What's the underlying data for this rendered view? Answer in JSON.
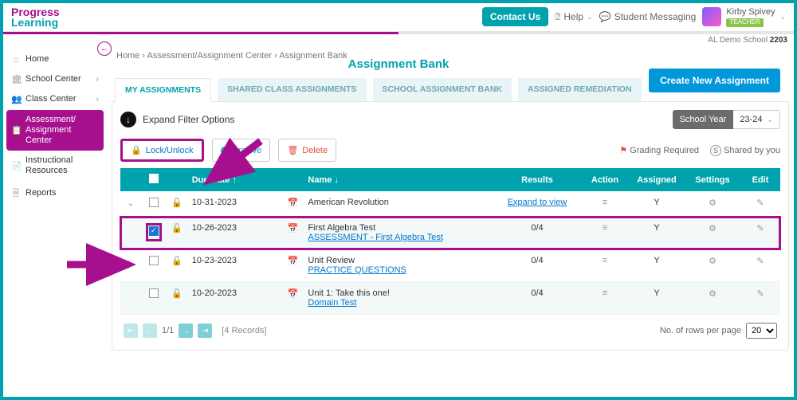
{
  "header": {
    "brand_p1": "Progress",
    "brand_p2": "Learning",
    "contact_label": "Contact Us",
    "help_label": "Help",
    "messaging_label": "Student Messaging",
    "user_name": "Kirby Spivey",
    "user_role": "TEACHER",
    "school_line_prefix": "AL Demo School ",
    "school_line_bold": "2203"
  },
  "sidebar": {
    "items": [
      {
        "icon": "⌂",
        "label": "Home"
      },
      {
        "icon": "🏛",
        "label": "School Center",
        "expandable": true
      },
      {
        "icon": "👥",
        "label": "Class Center",
        "expandable": true
      },
      {
        "icon": "📋",
        "label": "Assessment/ Assignment Center",
        "active": true
      },
      {
        "icon": "📄",
        "label": "Instructional Resources"
      },
      {
        "icon": "🗎",
        "label": "Reports"
      }
    ]
  },
  "breadcrumbs": {
    "a": "Home",
    "b": "Assessment/Assignment Center",
    "c": "Assignment Bank"
  },
  "page_title": "Assignment Bank",
  "tabs": [
    "MY ASSIGNMENTS",
    "SHARED CLASS ASSIGNMENTS",
    "SCHOOL ASSIGNMENT BANK",
    "ASSIGNED REMEDIATION"
  ],
  "buttons": {
    "create": "Create New Assignment",
    "expand_filter": "Expand Filter Options",
    "school_year_label": "School Year",
    "school_year_value": "23-24",
    "lock": "Lock/Unlock",
    "archive": "Archive",
    "delete": "Delete"
  },
  "legend": {
    "grading": "Grading Required",
    "shared": "Shared by you"
  },
  "columns": {
    "due": "Due Date",
    "name": "Name",
    "results": "Results",
    "action": "Action",
    "assigned": "Assigned",
    "settings": "Settings",
    "edit": "Edit"
  },
  "rows": [
    {
      "date": "10-31-2023",
      "title": "American Revolution",
      "sub": "",
      "results": "Expand to view",
      "results_link": true,
      "assigned": "Y",
      "expand": true
    },
    {
      "date": "10-26-2023",
      "title": "First Algebra Test",
      "sub": "ASSESSMENT - First Algebra Test",
      "results": "0/4",
      "assigned": "Y",
      "checked": true,
      "highlight": true
    },
    {
      "date": "10-23-2023",
      "title": "Unit Review",
      "sub": "PRACTICE QUESTIONS",
      "results": "0/4",
      "assigned": "Y"
    },
    {
      "date": "10-20-2023",
      "title": "Unit 1: Take this one!",
      "sub": "Domain Test",
      "results": "0/4",
      "assigned": "Y"
    }
  ],
  "pager": {
    "page": "1/1",
    "records": "[4 Records]",
    "rows_label": "No. of rows per page",
    "rows_value": "20"
  }
}
